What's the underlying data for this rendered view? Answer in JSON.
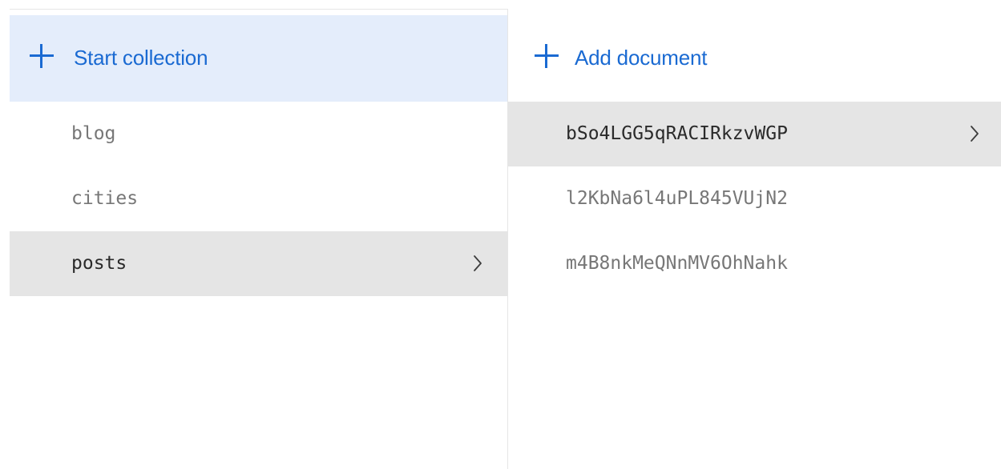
{
  "collections_panel": {
    "header": {
      "label": "Start collection",
      "icon": "plus-icon"
    },
    "items": [
      {
        "label": "blog",
        "selected": false
      },
      {
        "label": "cities",
        "selected": false
      },
      {
        "label": "posts",
        "selected": true,
        "icon": "chevron-right-icon"
      }
    ]
  },
  "documents_panel": {
    "header": {
      "label": "Add document",
      "icon": "plus-icon"
    },
    "items": [
      {
        "label": "bSo4LGG5qRACIRkzvWGP",
        "selected": true,
        "icon": "chevron-right-icon"
      },
      {
        "label": "l2KbNa6l4uPL845VUjN2",
        "selected": false
      },
      {
        "label": "m4B8nkMeQNnMV6OhNahk",
        "selected": false
      }
    ]
  },
  "colors": {
    "accent": "#1a6ad2",
    "header_highlight": "#e4edfb",
    "selected_row": "#e5e5e5",
    "muted_text": "#777777",
    "selected_text": "#2a2a2a",
    "divider": "#e6e6e6"
  }
}
